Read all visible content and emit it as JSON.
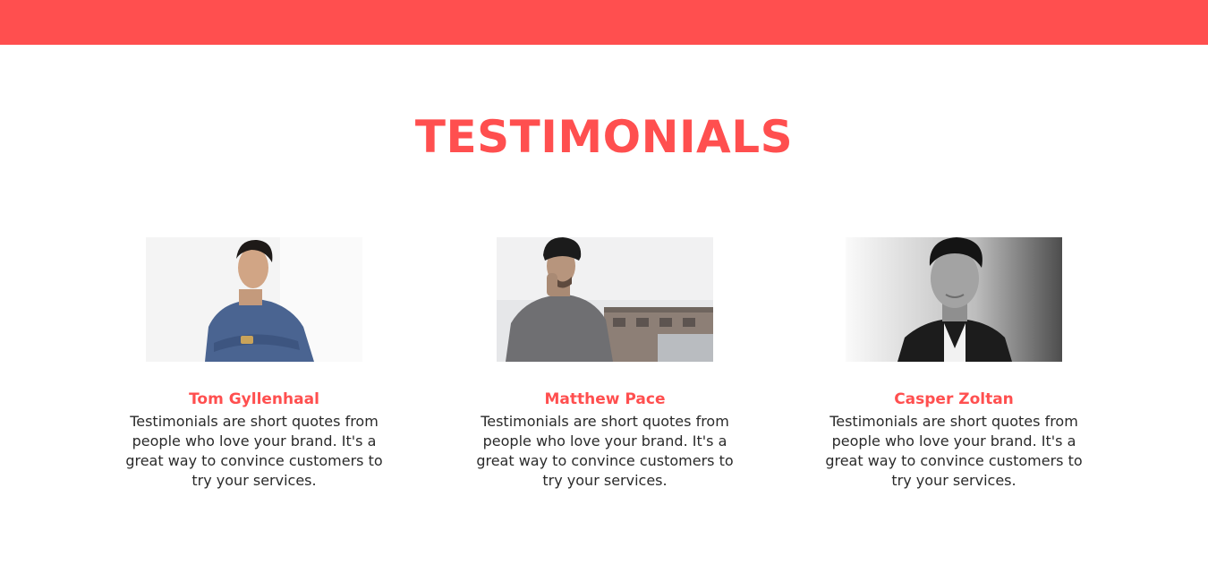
{
  "header": {
    "bar_color": "#ff4f4f"
  },
  "section": {
    "title": "TESTIMONIALS"
  },
  "testimonials": [
    {
      "name": "Tom Gyllenhaal",
      "quote": "Testimonials are short quotes from people who love your brand. It's a great way to convince customers to try your services."
    },
    {
      "name": "Matthew Pace",
      "quote": "Testimonials are short quotes from people who love your brand. It's a great way to convince customers to try your services."
    },
    {
      "name": "Casper Zoltan",
      "quote": "Testimonials are short quotes from people who love your brand. It's a great way to convince customers to try your services."
    }
  ],
  "colors": {
    "accent": "#ff4f4f",
    "text": "#2a2a2a",
    "background": "#ffffff"
  }
}
